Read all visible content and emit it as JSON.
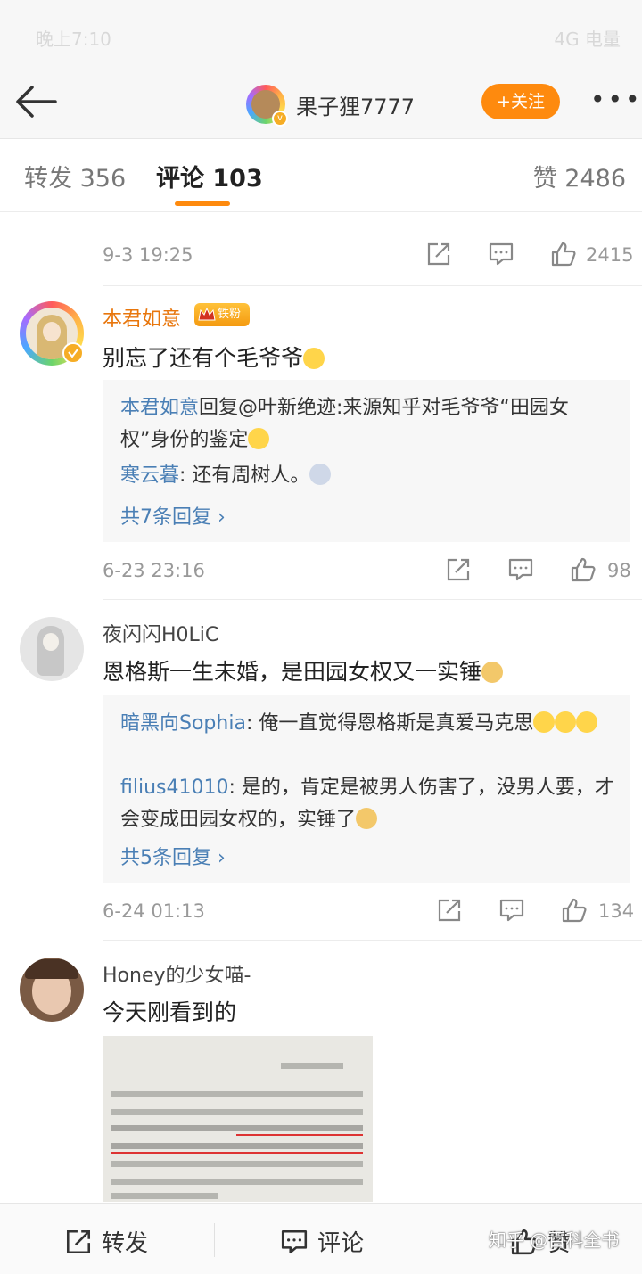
{
  "status_bar": {
    "left": "晚上7:10",
    "right": "4G 电量"
  },
  "nav": {
    "title": "果子狸7777",
    "follow_label": "+关注",
    "more_label": "•••"
  },
  "tabs": {
    "forward": "转发 356",
    "comment": "评论 103",
    "like": "赞 2486"
  },
  "post_actions": {
    "time": "9-3 19:25",
    "like_count": "2415"
  },
  "comments": [
    {
      "username": "本君如意",
      "badge": "铁粉",
      "text": "别忘了还有个毛爷爷",
      "replies": [
        {
          "name": "本君如意",
          "text": "回复@叶新绝迹:来源知乎对毛爷爷“田园女权”身份的鉴定"
        },
        {
          "name": "寒云暮",
          "text": ": 还有周树人。"
        }
      ],
      "more": "共7条回复 ›",
      "time": "6-23 23:16",
      "like_count": "98"
    },
    {
      "username": "夜闪闪H0LiC",
      "text": "恩格斯一生未婚，是田园女权又一实锤",
      "replies": [
        {
          "name": "暗黑向Sophia",
          "text": ": 俺一直觉得恩格斯是真爱马克思"
        },
        {
          "name": "filius41010",
          "text": ": 是的，肯定是被男人伤害了，没男人要，才会变成田园女权的，实锤了"
        }
      ],
      "more": "共5条回复 ›",
      "time": "6-24 01:13",
      "like_count": "134"
    },
    {
      "username": "Honey的少女喵-",
      "text": "今天刚看到的"
    }
  ],
  "bottom_bar": {
    "forward": "转发",
    "comment": "评论",
    "like": "赞"
  },
  "watermark": "知乎 @百科全书",
  "colors": {
    "accent": "#fe8a0e",
    "link": "#4a7fb5",
    "username_orange": "#e8760c"
  }
}
